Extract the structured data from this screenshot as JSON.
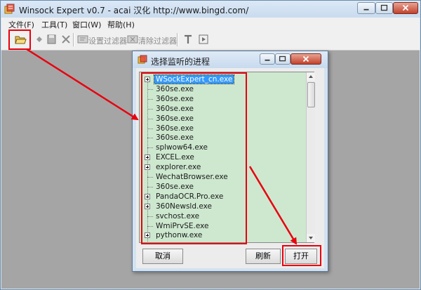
{
  "window": {
    "title": "Winsock Expert v0.7 - acai 汉化 http://www.bingd.com/",
    "icon": "winsock-app-icon"
  },
  "menu": {
    "items": [
      {
        "label": "文件(F)"
      },
      {
        "label": "工具(T)"
      },
      {
        "label": "窗口(W)"
      },
      {
        "label": "帮助(H)"
      }
    ]
  },
  "toolbar": {
    "open_icon": "folder-open-icon",
    "filter_settings_label": "设置过滤器",
    "clear_filter_label": "清除过滤器"
  },
  "dialog": {
    "title": "选择监听的进程",
    "processes": [
      {
        "name": "WSockExpert_cn.exe",
        "expandable": true,
        "selected": true
      },
      {
        "name": "360se.exe",
        "expandable": false
      },
      {
        "name": "360se.exe",
        "expandable": false
      },
      {
        "name": "360se.exe",
        "expandable": false
      },
      {
        "name": "360se.exe",
        "expandable": false
      },
      {
        "name": "360se.exe",
        "expandable": false
      },
      {
        "name": "360se.exe",
        "expandable": false
      },
      {
        "name": "splwow64.exe",
        "expandable": false
      },
      {
        "name": "EXCEL.exe",
        "expandable": true
      },
      {
        "name": "explorer.exe",
        "expandable": true
      },
      {
        "name": "WechatBrowser.exe",
        "expandable": false
      },
      {
        "name": "360se.exe",
        "expandable": false
      },
      {
        "name": "PandaOCR.Pro.exe",
        "expandable": true
      },
      {
        "name": "360Newsld.exe",
        "expandable": true
      },
      {
        "name": "svchost.exe",
        "expandable": false
      },
      {
        "name": "WmiPrvSE.exe",
        "expandable": false
      },
      {
        "name": "pythonw.exe",
        "expandable": true
      }
    ],
    "buttons": {
      "cancel": "取消",
      "refresh": "刷新",
      "open": "打开"
    }
  },
  "colors": {
    "annotation_red": "#e8000f",
    "tree_background": "#cde8cf",
    "selection": "#3399ff"
  }
}
